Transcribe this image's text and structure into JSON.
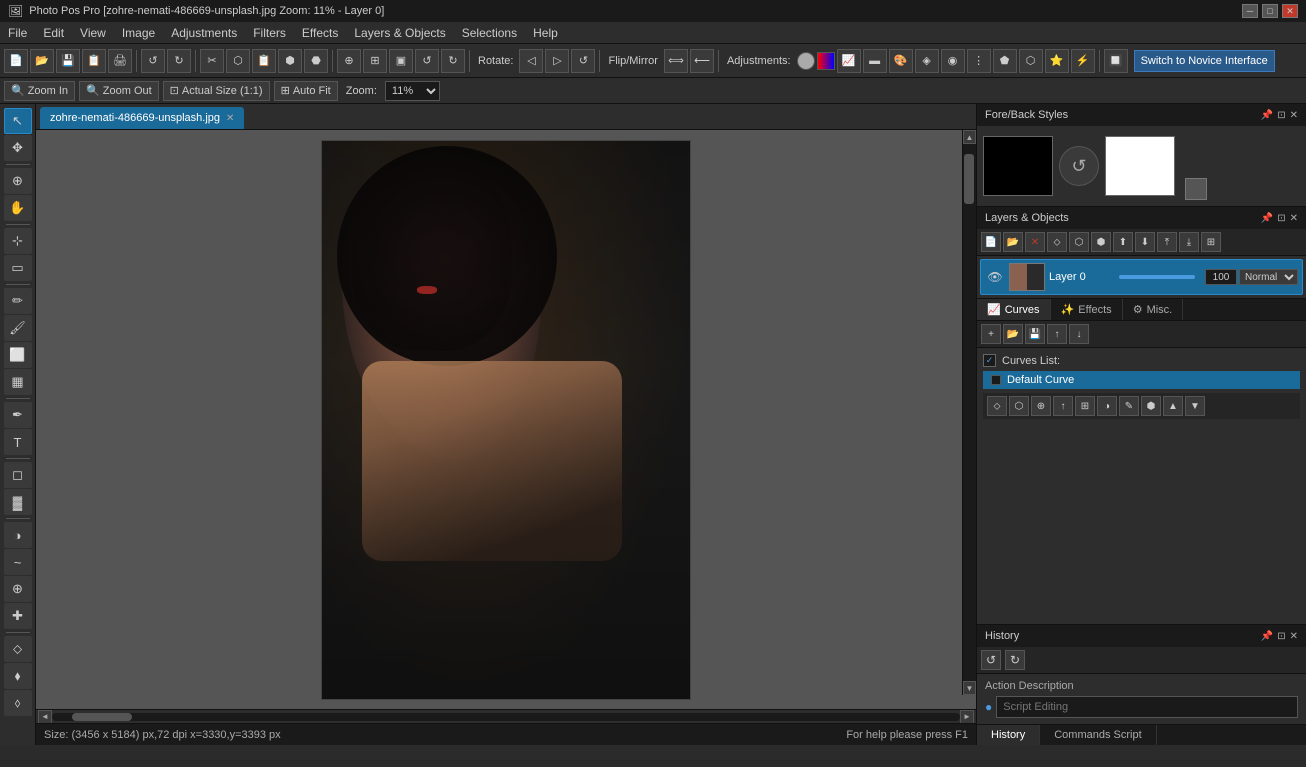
{
  "titlebar": {
    "title": "Photo Pos Pro [zohre-nemati-486669-unsplash.jpg  Zoom: 11% - Layer 0]",
    "min": "─",
    "max": "□",
    "close": "✕"
  },
  "menubar": {
    "items": [
      "File",
      "Edit",
      "View",
      "Image",
      "Adjustments",
      "Filters",
      "Effects",
      "Layers & Objects",
      "Selections",
      "Help"
    ]
  },
  "toolbar": {
    "zoom_label": "Zoom In",
    "zoom_out_label": "Zoom Out",
    "actual_size_label": "Actual Size (1:1)",
    "auto_fit_label": "Auto Fit",
    "zoom_prefix": "Zoom:",
    "zoom_value": "11%",
    "rotate_label": "Rotate:",
    "flipmirror_label": "Flip/Mirror",
    "adjustments_label": "Adjustments:",
    "switch_novice": "Switch to Novice Interface"
  },
  "canvas": {
    "tab_name": "zohre-nemati-486669-unsplash.jpg",
    "status": "Size: (3456 x 5184) px,72 dpi  x=3330,y=3393 px",
    "help": "For help please press F1"
  },
  "foreback": {
    "title": "Fore/Back Styles"
  },
  "layers": {
    "title": "Layers & Objects",
    "items": [
      {
        "name": "Layer 0",
        "opacity": "100",
        "blend": "Normal",
        "visible": true
      }
    ]
  },
  "tabs": {
    "curves": "Curves",
    "effects": "Effects",
    "misc": "Misc."
  },
  "curves": {
    "list_label": "Curves List:",
    "default_curve": "Default Curve"
  },
  "history": {
    "title": "History",
    "action_label": "Action Description",
    "action_placeholder": "Script Editing",
    "tab_history": "History",
    "tab_commands": "Commands Script"
  },
  "icons": {
    "arrow": "↖",
    "move": "✥",
    "zoom_tool": "🔍",
    "eyedropper": "✒",
    "crop": "⊹",
    "pencil": "✏",
    "brush": "🖌",
    "eraser": "⬜",
    "fill": "▦",
    "text": "T",
    "shape": "◻",
    "gradient": "▓",
    "dodge": "◑",
    "smudge": "~",
    "clone": "⊕",
    "healing": "✚",
    "eye": "👁",
    "refresh": "↺",
    "new": "📄",
    "open": "📂",
    "save": "💾",
    "undo": "↺",
    "redo": "↻",
    "pin": "📌",
    "unpin": "🔓",
    "close_panel": "✕"
  }
}
